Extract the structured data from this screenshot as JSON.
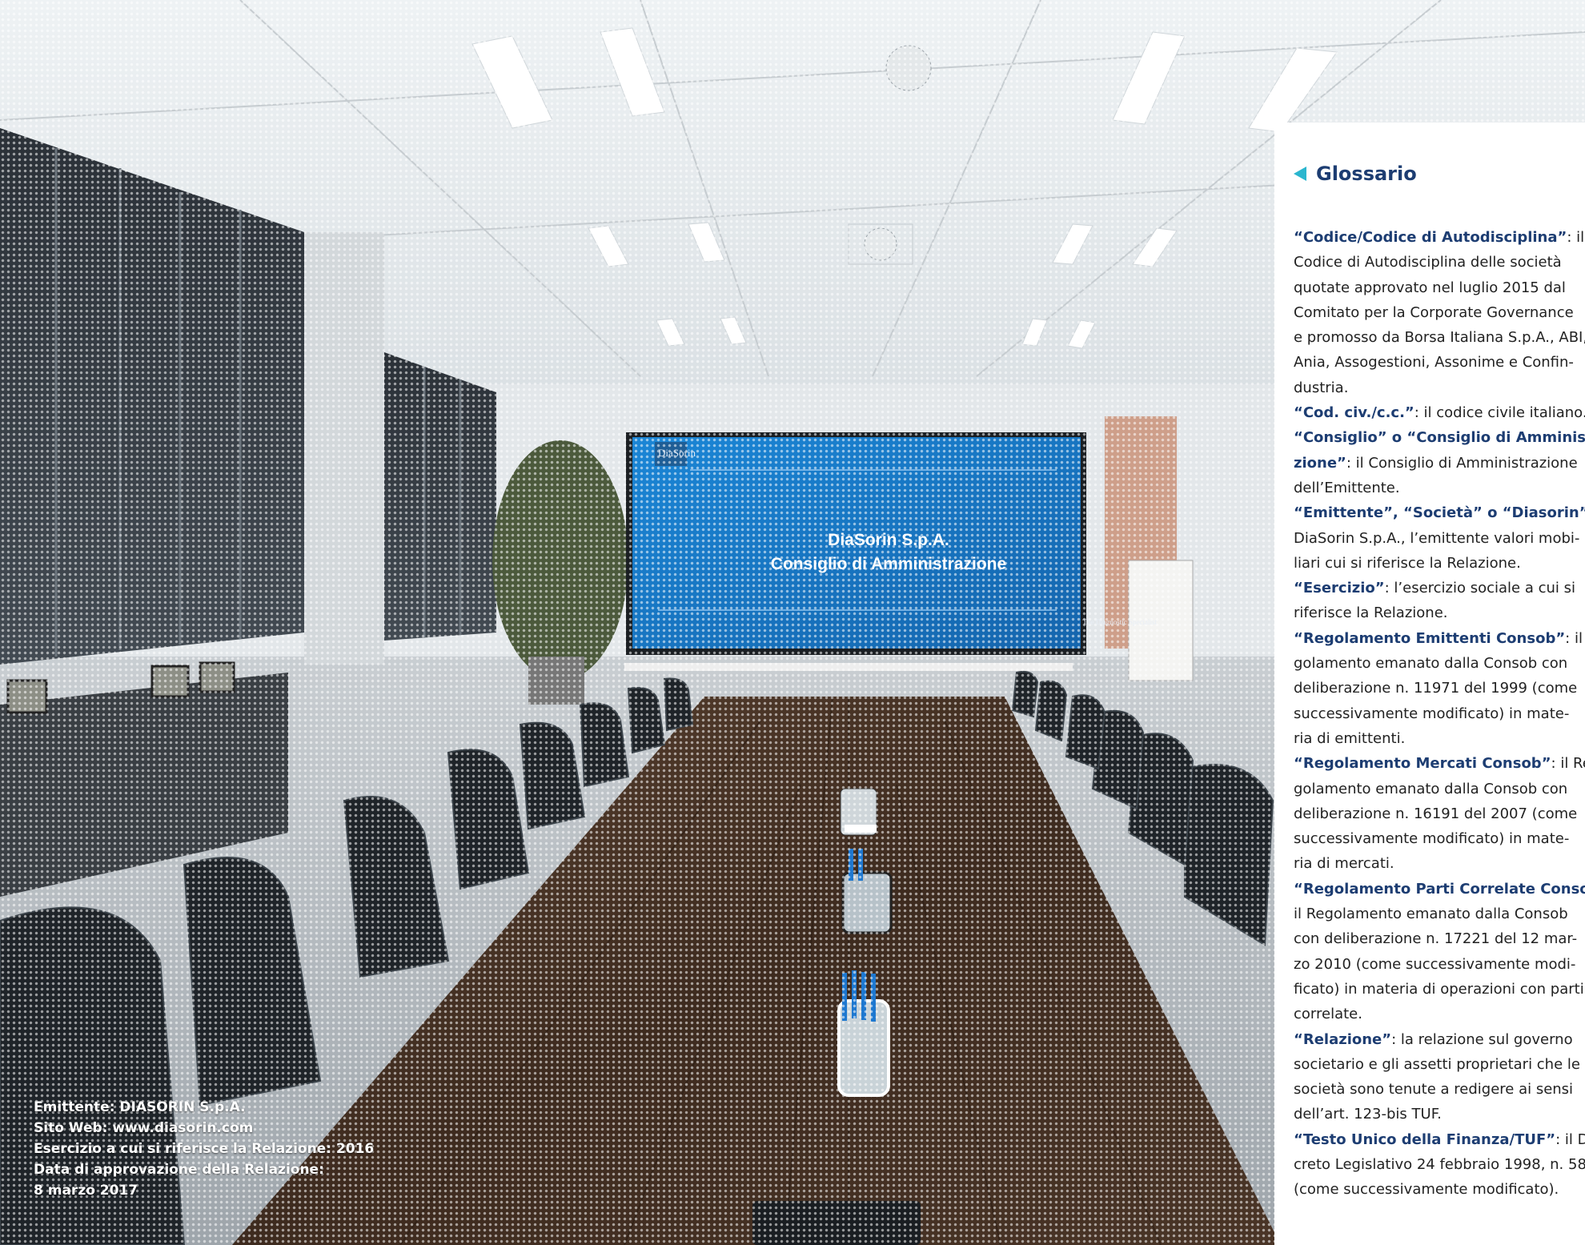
{
  "screen": {
    "logo": "DiaSorin",
    "title_line1": "DiaSorin S.p.A.",
    "title_line2": "Consiglio di Amministrazione",
    "tagline": "The Diagnostic Specialist"
  },
  "caption": {
    "line1": "Emittente: DIASORIN S.p.A.",
    "line2": "Sito Web: www.diasorin.com",
    "line3": "Esercizio a cui si riferisce la Relazione: 2016",
    "line4": "Data di approvazione della Relazione:",
    "line5": "8 marzo 2017"
  },
  "glossary": {
    "title": "Glossario",
    "lines": [
      {
        "term": "“Codice/Codice di Autodisciplina”",
        "text": ": il"
      },
      {
        "term": "",
        "text": "Codice di Autodisciplina delle società"
      },
      {
        "term": "",
        "text": "quotate approvato nel luglio 2015 dal"
      },
      {
        "term": "",
        "text": "Comitato per la Corporate Governance"
      },
      {
        "term": "",
        "text": "e promosso da Borsa Italiana S.p.A., ABI,"
      },
      {
        "term": "",
        "text": "Ania, Assogestioni, Assonime e Confin-"
      },
      {
        "term": "",
        "text": "dustria."
      },
      {
        "term": "“Cod. civ./c.c.”",
        "text": ": il codice civile italiano."
      },
      {
        "term": "“Consiglio” o “Consiglio di Amministra-",
        "text": ""
      },
      {
        "term": "zione”",
        "text": ": il Consiglio di Amministrazione"
      },
      {
        "term": "",
        "text": "dell’Emittente."
      },
      {
        "term": "“Emittente”, “Società” o “Diasorin”",
        "text": ":"
      },
      {
        "term": "",
        "text": "DiaSorin S.p.A., l’emittente valori mobi-"
      },
      {
        "term": "",
        "text": "liari cui si riferisce la Relazione."
      },
      {
        "term": "“Esercizio”",
        "text": ": l’esercizio sociale a cui si"
      },
      {
        "term": "",
        "text": "riferisce la Relazione."
      },
      {
        "term": "“Regolamento Emittenti Consob”",
        "text": ": il Re-"
      },
      {
        "term": "",
        "text": "golamento emanato dalla Consob con"
      },
      {
        "term": "",
        "text": "deliberazione n. 11971 del 1999 (come"
      },
      {
        "term": "",
        "text": "successivamente modificato) in mate-"
      },
      {
        "term": "",
        "text": "ria di emittenti."
      },
      {
        "term": "“Regolamento Mercati Consob”",
        "text": ": il Re-"
      },
      {
        "term": "",
        "text": "golamento emanato dalla Consob con"
      },
      {
        "term": "",
        "text": "deliberazione n. 16191 del 2007 (come"
      },
      {
        "term": "",
        "text": "successivamente modificato) in mate-"
      },
      {
        "term": "",
        "text": "ria di mercati."
      },
      {
        "term": "“Regolamento Parti Correlate Consob”",
        "text": ":"
      },
      {
        "term": "",
        "text": "il Regolamento emanato dalla Consob"
      },
      {
        "term": "",
        "text": "con deliberazione n. 17221 del 12 mar-"
      },
      {
        "term": "",
        "text": "zo 2010 (come successivamente modi-"
      },
      {
        "term": "",
        "text": "ficato) in materia di operazioni con parti"
      },
      {
        "term": "",
        "text": "correlate."
      },
      {
        "term": "“Relazione”",
        "text": ": la relazione sul governo"
      },
      {
        "term": "",
        "text": "societario e gli assetti proprietari che le"
      },
      {
        "term": "",
        "text": "società sono tenute a redigere ai sensi"
      },
      {
        "term": "",
        "text": "dell’art. 123-bis TUF."
      },
      {
        "term": "“Testo Unico della Finanza/TUF”",
        "text": ": il De-"
      },
      {
        "term": "",
        "text": "creto Legislativo 24 febbraio 1998, n. 58"
      },
      {
        "term": "",
        "text": "(come successivamente modificato)."
      }
    ]
  },
  "colors": {
    "accent": "#2bb6cf",
    "term": "#1d3d72",
    "screen_blue": "#1a7fd0"
  }
}
